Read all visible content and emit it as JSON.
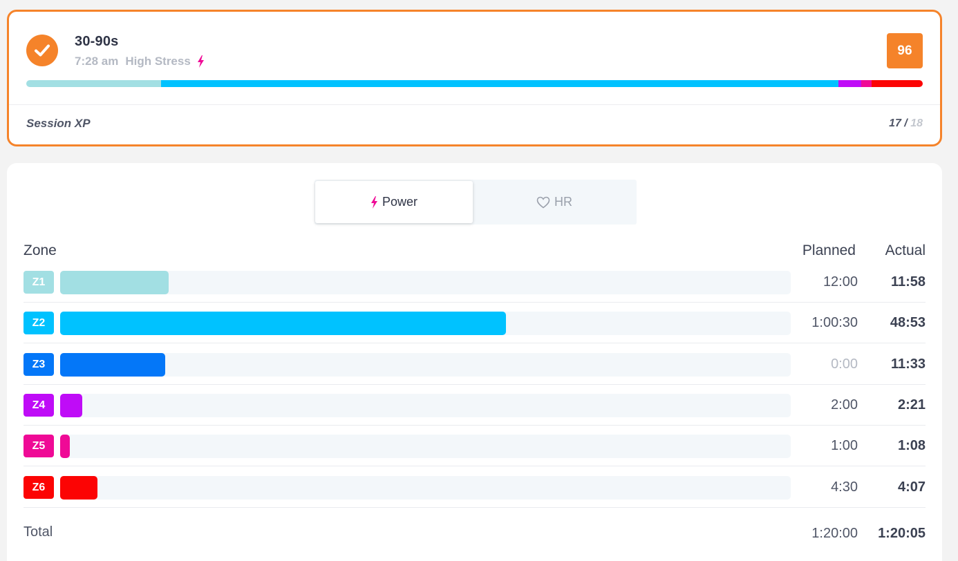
{
  "session": {
    "title": "30-90s",
    "time": "7:28 am",
    "stress_label": "High Stress",
    "score": "96",
    "xp_label": "Session XP",
    "xp_current": "17",
    "xp_separator": " / ",
    "xp_max": "18",
    "accent_color": "#f5832a",
    "strip": [
      {
        "zone": "Z1",
        "fraction": 0.15,
        "color": "#a2dfe3"
      },
      {
        "zone": "Z2",
        "fraction": 0.756,
        "color": "#00c2ff"
      },
      {
        "zone": "Z4",
        "fraction": 0.025,
        "color": "#bf0cf7"
      },
      {
        "zone": "Z5",
        "fraction": 0.012,
        "color": "#ef0a96"
      },
      {
        "zone": "Z6",
        "fraction": 0.057,
        "color": "#fc0404"
      }
    ]
  },
  "toggle": {
    "power_label": "Power",
    "hr_label": "HR",
    "active": "power"
  },
  "zones_table": {
    "header_zone": "Zone",
    "header_planned": "Planned",
    "header_actual": "Actual",
    "rows": [
      {
        "zone": "Z1",
        "color": "#a2dfe3",
        "fill": 0.149,
        "planned": "12:00",
        "actual": "11:58",
        "planned_muted": false
      },
      {
        "zone": "Z2",
        "color": "#00c2ff",
        "fill": 0.61,
        "planned": "1:00:30",
        "actual": "48:53",
        "planned_muted": false
      },
      {
        "zone": "Z3",
        "color": "#0477f8",
        "fill": 0.144,
        "planned": "0:00",
        "actual": "11:33",
        "planned_muted": true
      },
      {
        "zone": "Z4",
        "color": "#bf0cf7",
        "fill": 0.03,
        "planned": "2:00",
        "actual": "2:21",
        "planned_muted": false
      },
      {
        "zone": "Z5",
        "color": "#ef0a96",
        "fill": 0.013,
        "planned": "1:00",
        "actual": "1:08",
        "planned_muted": false
      },
      {
        "zone": "Z6",
        "color": "#fc0404",
        "fill": 0.051,
        "planned": "4:30",
        "actual": "4:07",
        "planned_muted": false
      }
    ],
    "total_label": "Total",
    "total_planned": "1:20:00",
    "total_actual": "1:20:05"
  }
}
